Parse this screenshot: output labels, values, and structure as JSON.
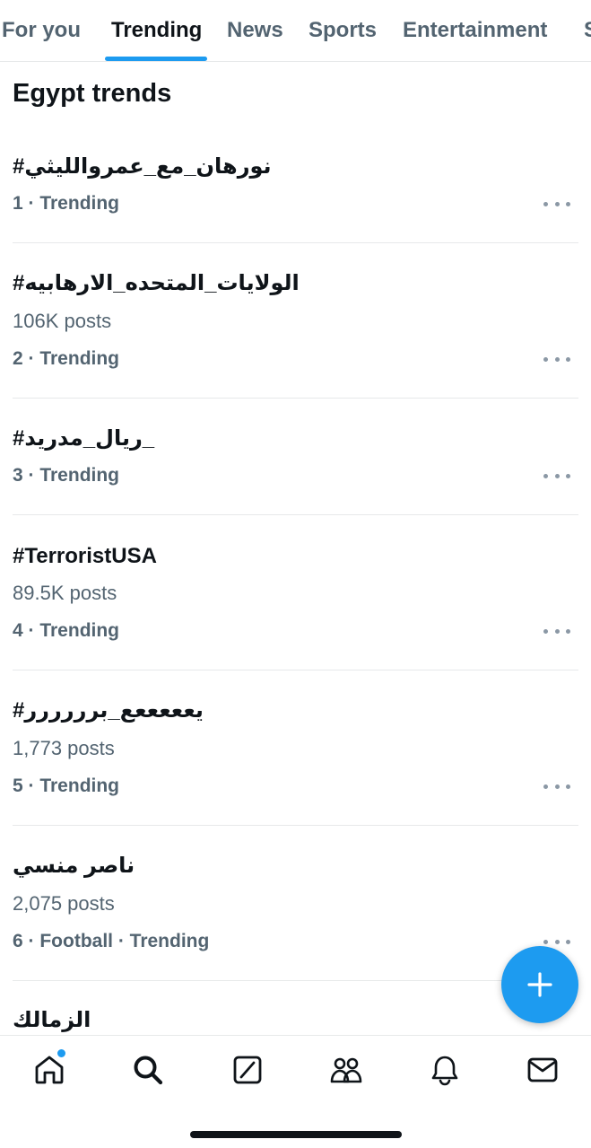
{
  "tabs": [
    {
      "label": "For you"
    },
    {
      "label": "Trending"
    },
    {
      "label": "News"
    },
    {
      "label": "Sports"
    },
    {
      "label": "Entertainment"
    },
    {
      "label": "S"
    }
  ],
  "active_tab": "Trending",
  "section_title": "Egypt trends",
  "trends": [
    {
      "name": "#نورهان_مع_عمروالليثي",
      "posts": "",
      "meta": "1 · Trending"
    },
    {
      "name": "#الولايات_المتحده_الارهابيه",
      "posts": "106K posts",
      "meta": "2 · Trending"
    },
    {
      "name": "#ريال_مدريد_",
      "posts": "",
      "meta": "3 · Trending"
    },
    {
      "name": "#TerroristUSA",
      "posts": "89.5K posts",
      "meta": "4 · Trending"
    },
    {
      "name": "#يعععععع_برررررر",
      "posts": "1,773 posts",
      "meta": "5 · Trending"
    },
    {
      "name": "ناصر منسي",
      "posts": "2,075 posts",
      "meta": "6 · Football · Trending"
    },
    {
      "name": "الزمالك",
      "posts": "",
      "meta": ""
    }
  ],
  "icons": {
    "fab": "plus-icon",
    "nav": [
      "home-icon",
      "search-icon",
      "grok-icon",
      "communities-icon",
      "bell-icon",
      "mail-icon"
    ],
    "more": "more-dots-icon"
  },
  "colors": {
    "accent": "#1d9bf0",
    "text_primary": "#0f1419",
    "text_secondary": "#536471",
    "divider": "#e7e9ea"
  }
}
